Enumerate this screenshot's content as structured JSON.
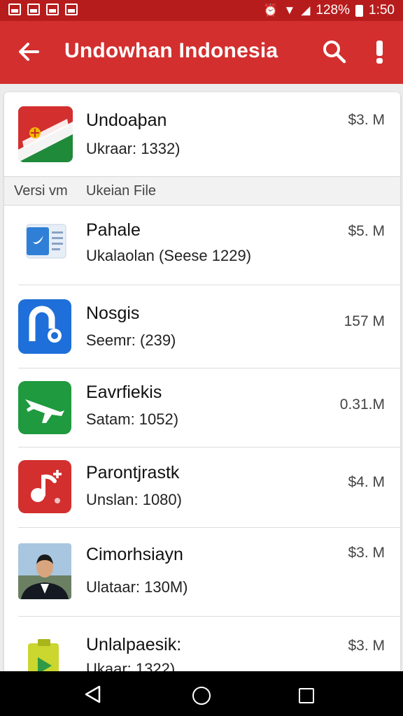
{
  "status_bar": {
    "battery_percent": "128%",
    "time": "1:50"
  },
  "app_bar": {
    "title": "Undowhan Indonesia"
  },
  "featured": {
    "name": "Undoaþan",
    "subtitle": "Ukraar: 1332)",
    "size": "$3. M"
  },
  "section_header": {
    "col1": "Versi vm",
    "col2": "Ukeian File"
  },
  "items": [
    {
      "name": "Pahale",
      "subtitle": "Ukalaolan (Seese 1229)",
      "size": "$5. M",
      "icon": "document-icon",
      "color": "#2f7fd6"
    },
    {
      "name": "Nosgis",
      "subtitle": "Seemr: (239)",
      "size": "157 M",
      "icon": "n-letter-icon",
      "color": "#1e6fd9"
    },
    {
      "name": "Eavrfiekis",
      "subtitle": "Satam: 1052)",
      "size": "0.31.M",
      "icon": "airplane-icon",
      "color": "#1f9a3f"
    },
    {
      "name": "Parontjrastk",
      "subtitle": "Unslan: 1080)",
      "size": "$4. M",
      "icon": "music-note-icon",
      "color": "#d32f2f"
    },
    {
      "name": "Cimorhsiayn",
      "subtitle": "Ulataar: 130M)",
      "size": "$3. M",
      "icon": "person-photo-icon",
      "color": "#1b2330"
    },
    {
      "name": "Unlalpaesik:",
      "subtitle": "Ukaar: 1322)",
      "size": "$3. M",
      "icon": "play-icon",
      "color": "#cbd62e"
    }
  ]
}
